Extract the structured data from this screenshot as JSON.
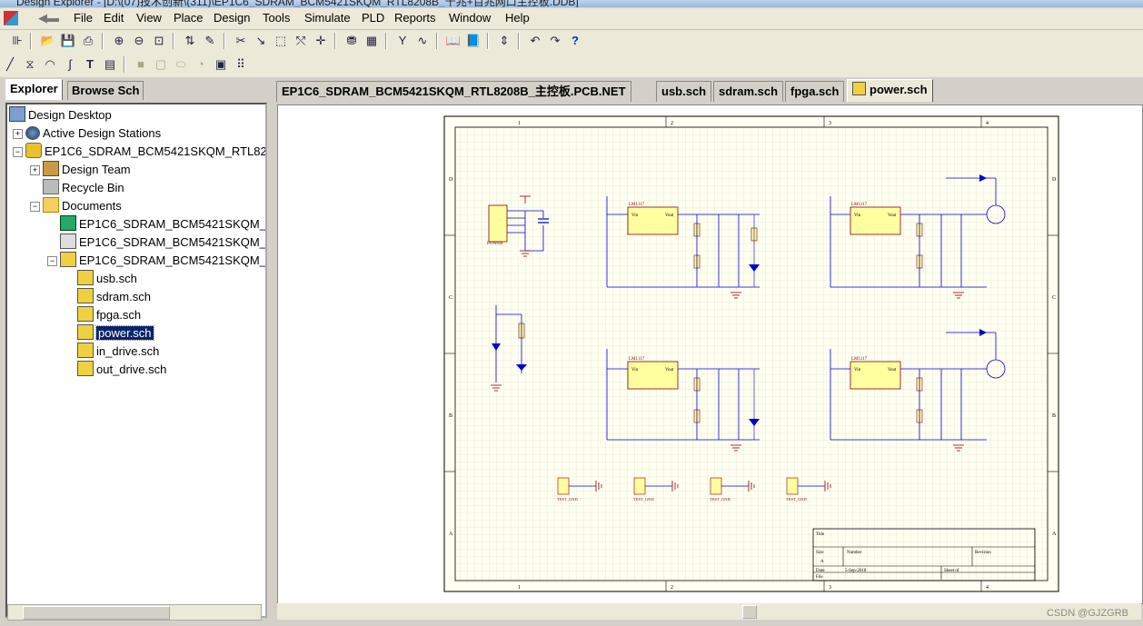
{
  "window": {
    "title": "Design Explorer - [D:\\(07)技术创新\\(311)\\EP1C6_SDRAM_BCM5421SKQM_RTL8208B_千兆+百兆网口主控板.DDB]"
  },
  "menu": [
    "File",
    "Edit",
    "View",
    "Place",
    "Design",
    "Tools",
    "Simulate",
    "PLD",
    "Reports",
    "Window",
    "Help"
  ],
  "left_tabs": [
    "Explorer",
    "Browse Sch"
  ],
  "tree": {
    "design_desktop": "Design Desktop",
    "active_stations": "Active Design Stations",
    "project": "EP1C6_SDRAM_BCM5421SKQM_RTL8208",
    "design_team": "Design Team",
    "recycle_bin": "Recycle Bin",
    "documents": "Documents",
    "doc1": "EP1C6_SDRAM_BCM5421SKQM_RT",
    "doc2": "EP1C6_SDRAM_BCM5421SKQM_RT",
    "doc3": "EP1C6_SDRAM_BCM5421SKQM_RT",
    "sheets": [
      "usb.sch",
      "sdram.sch",
      "fpga.sch",
      "power.sch",
      "in_drive.sch",
      "out_drive.sch"
    ]
  },
  "doc_tabs": [
    "EP1C6_SDRAM_BCM5421SKQM_RTL8208B_主控板.PCB.NET",
    "usb.sch",
    "sdram.sch",
    "fpga.sch",
    "power.sch"
  ],
  "schematic": {
    "zone_letters": [
      "D",
      "C",
      "B",
      "A"
    ],
    "zone_numbers": [
      "1",
      "2",
      "3",
      "4"
    ],
    "title_block": {
      "title": "Title",
      "size": "Size",
      "size_val": "A",
      "number": "Number",
      "revision": "Revision",
      "date": "Date",
      "date_val": "5-Sep-2018",
      "sheet": "Sheet of",
      "file": "File"
    },
    "regulator_part": "LM1117",
    "regulator_pins": [
      "Vin",
      "GND",
      "Vout"
    ],
    "power_connector": "POWER",
    "test_label": "TEST_GND"
  },
  "watermark": "CSDN @GJZGRB"
}
